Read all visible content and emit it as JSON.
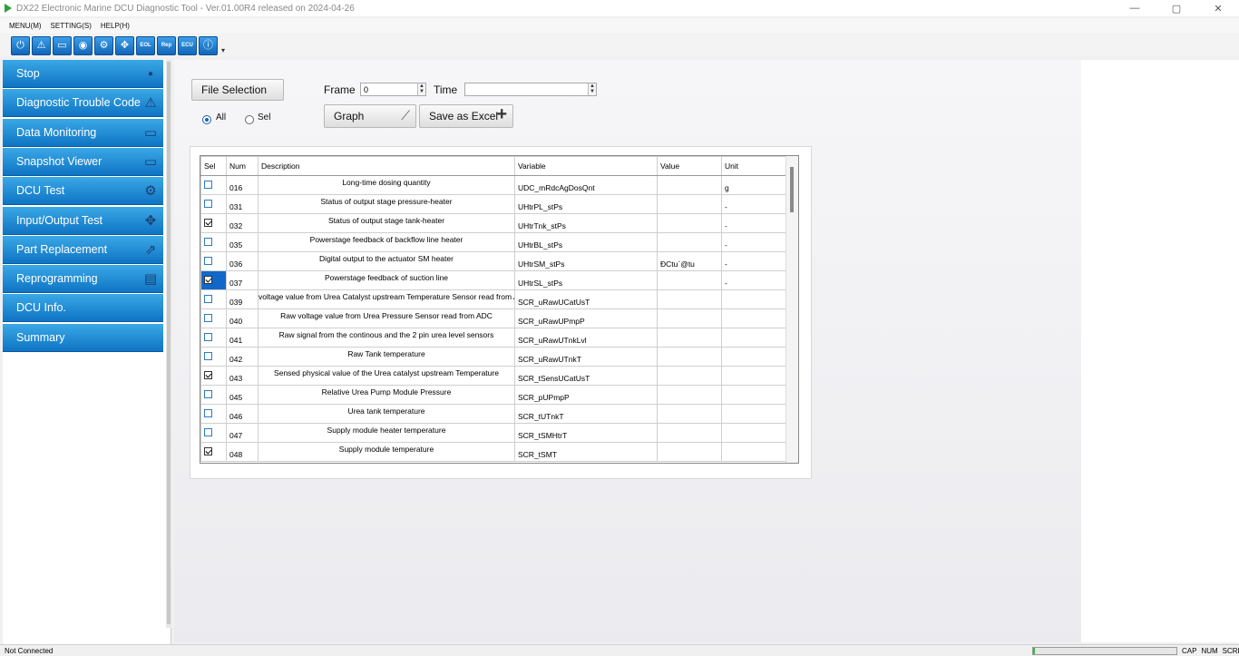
{
  "window": {
    "title": "DX22 Electronic Marine DCU Diagnostic Tool - Ver.01.00R4 released on 2024-04-26",
    "controls": [
      "—",
      "▢",
      "✕"
    ]
  },
  "menu": [
    "MENU(M)",
    "SETTING(S)",
    "HELP(H)"
  ],
  "toolbar": [
    {
      "icon": "power-icon",
      "glyph": "⏻"
    },
    {
      "icon": "warning-icon",
      "glyph": "⚠"
    },
    {
      "icon": "monitor-icon",
      "glyph": "▭"
    },
    {
      "icon": "camera-icon",
      "glyph": "◉"
    },
    {
      "icon": "dcu-test-icon",
      "glyph": "⚙"
    },
    {
      "icon": "io-test-icon",
      "glyph": "✥"
    },
    {
      "icon": "eol-icon",
      "glyph": "EOL"
    },
    {
      "icon": "reprogram-icon",
      "glyph": "Rep"
    },
    {
      "icon": "ecu-icon",
      "glyph": "ECU"
    },
    {
      "icon": "info-icon",
      "glyph": "ⓘ"
    }
  ],
  "sidebar": {
    "items": [
      {
        "label": "Stop",
        "icon": "stop-icon",
        "glyph": "▪"
      },
      {
        "label": "Diagnostic Trouble Code",
        "icon": "warning-icon",
        "glyph": "⚠"
      },
      {
        "label": "Data Monitoring",
        "icon": "monitor-icon",
        "glyph": "▭"
      },
      {
        "label": "Snapshot Viewer",
        "icon": "monitor-icon",
        "glyph": "▭"
      },
      {
        "label": "DCU Test",
        "icon": "dcu-test-icon",
        "glyph": "⚙"
      },
      {
        "label": "Input/Output Test",
        "icon": "io-test-icon",
        "glyph": "✥"
      },
      {
        "label": "Part Replacement",
        "icon": "replace-icon",
        "glyph": "⇗"
      },
      {
        "label": "Reprogramming",
        "icon": "reprogram-icon",
        "glyph": "▤"
      },
      {
        "label": "DCU Info.",
        "icon": "",
        "glyph": ""
      },
      {
        "label": "Summary",
        "icon": "",
        "glyph": ""
      }
    ]
  },
  "controls": {
    "file_selection": "File Selection",
    "frame_label": "Frame",
    "frame_value": "0",
    "time_label": "Time",
    "time_value": "",
    "radio_all": "All",
    "radio_sel": "Sel",
    "graph": "Graph",
    "save_excel": "Save as Excel"
  },
  "table": {
    "headers": [
      "Sel",
      "Num",
      "Description",
      "Variable",
      "Value",
      "Unit"
    ],
    "rows": [
      {
        "checked": false,
        "num": "016",
        "desc": "Long-time dosing quantity",
        "var": "UDC_mRdcAgDosQnt",
        "val": "",
        "unit": "g",
        "highlight": false
      },
      {
        "checked": false,
        "num": "031",
        "desc": "Status of output stage pressure-heater",
        "var": "UHtrPL_stPs",
        "val": "",
        "unit": "-",
        "highlight": false
      },
      {
        "checked": true,
        "num": "032",
        "desc": "Status of output stage tank-heater",
        "var": "UHtrTnk_stPs",
        "val": "",
        "unit": "-",
        "highlight": false
      },
      {
        "checked": false,
        "num": "035",
        "desc": "Powerstage feedback of backflow line heater",
        "var": "UHtrBL_stPs",
        "val": "",
        "unit": "-",
        "highlight": false
      },
      {
        "checked": false,
        "num": "036",
        "desc": "Digital output to the actuator SM heater",
        "var": "UHtrSM_stPs",
        "val": "ĐCtu`@tu",
        "unit": "-",
        "highlight": false
      },
      {
        "checked": true,
        "num": "037",
        "desc": "Powerstage feedback of suction line",
        "var": "UHtrSL_stPs",
        "val": "",
        "unit": "-",
        "highlight": true
      },
      {
        "checked": false,
        "num": "039",
        "desc": "voltage value from Urea Catalyst upstream Temperature Sensor read from ADC",
        "var": "SCR_uRawUCatUsT",
        "val": "",
        "unit": "",
        "highlight": false
      },
      {
        "checked": false,
        "num": "040",
        "desc": "Raw voltage value from Urea Pressure Sensor read from ADC",
        "var": "SCR_uRawUPmpP",
        "val": "",
        "unit": "",
        "highlight": false
      },
      {
        "checked": false,
        "num": "041",
        "desc": "Raw signal from the continous and the 2 pin urea level sensors",
        "var": "SCR_uRawUTnkLvl",
        "val": "",
        "unit": "",
        "highlight": false
      },
      {
        "checked": false,
        "num": "042",
        "desc": "Raw Tank temperature",
        "var": "SCR_uRawUTnkT",
        "val": "",
        "unit": "",
        "highlight": false
      },
      {
        "checked": true,
        "num": "043",
        "desc": "Sensed physical value of the Urea catalyst upstream Temperature",
        "var": "SCR_tSensUCatUsT",
        "val": "",
        "unit": "",
        "highlight": false
      },
      {
        "checked": false,
        "num": "045",
        "desc": "Relative Urea Pump Module Pressure",
        "var": "SCR_pUPmpP",
        "val": "",
        "unit": "",
        "highlight": false
      },
      {
        "checked": false,
        "num": "046",
        "desc": "Urea tank temperature",
        "var": "SCR_tUTnkT",
        "val": "",
        "unit": "",
        "highlight": false
      },
      {
        "checked": false,
        "num": "047",
        "desc": "Supply module heater temperature",
        "var": "SCR_tSMHtrT",
        "val": "",
        "unit": "",
        "highlight": false
      },
      {
        "checked": true,
        "num": "048",
        "desc": "Supply module temperature",
        "var": "SCR_tSMT",
        "val": "",
        "unit": "",
        "highlight": false
      }
    ]
  },
  "status": {
    "connection": "Not Connected",
    "progress": 0.01,
    "flags": [
      "CAP",
      "NUM",
      "SCRL"
    ]
  },
  "colors": {
    "nav_top": "#3aa8e6",
    "nav_bottom": "#0f74c4",
    "highlight": "#1168c8",
    "progress": "#2fc23b"
  }
}
